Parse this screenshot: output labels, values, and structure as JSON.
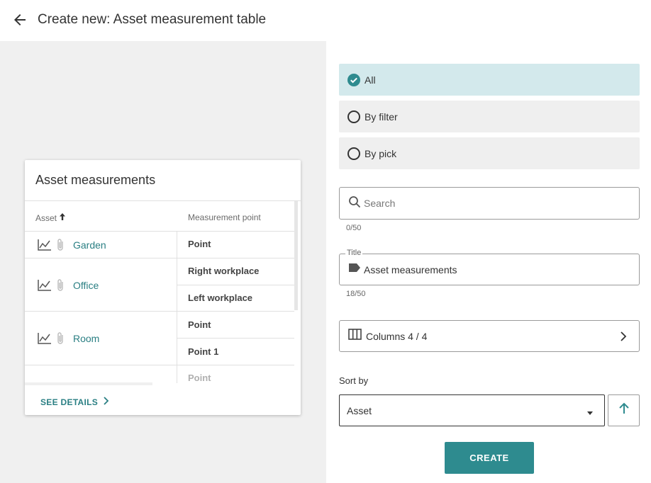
{
  "header": {
    "title": "Create new: Asset measurement table"
  },
  "preview": {
    "card_title": "Asset measurements",
    "columns": {
      "asset": "Asset",
      "measurement_point": "Measurement point"
    },
    "rows": [
      {
        "asset": "Garden",
        "points": [
          "Point"
        ]
      },
      {
        "asset": "Office",
        "points": [
          "Right workplace",
          "Left workplace"
        ]
      },
      {
        "asset": "Room",
        "points": [
          "Point",
          "Point 1"
        ]
      },
      {
        "asset": "",
        "points": [
          "Point"
        ]
      }
    ],
    "see_details": "SEE DETAILS"
  },
  "scope": {
    "options": [
      {
        "label": "All",
        "selected": true
      },
      {
        "label": "By filter",
        "selected": false
      },
      {
        "label": "By pick",
        "selected": false
      }
    ]
  },
  "search": {
    "placeholder": "Search",
    "counter": "0/50"
  },
  "title_field": {
    "legend": "Title",
    "value": "Asset measurements",
    "counter": "18/50"
  },
  "columns_button": {
    "label": "Columns 4 / 4"
  },
  "sort": {
    "label": "Sort by",
    "value": "Asset"
  },
  "create_button": {
    "label": "CREATE"
  },
  "colors": {
    "accent": "#2e8b8f",
    "selected_bg": "#d3e9ec",
    "link": "#2a7f83",
    "preview_bg": "#f0f0f0"
  }
}
